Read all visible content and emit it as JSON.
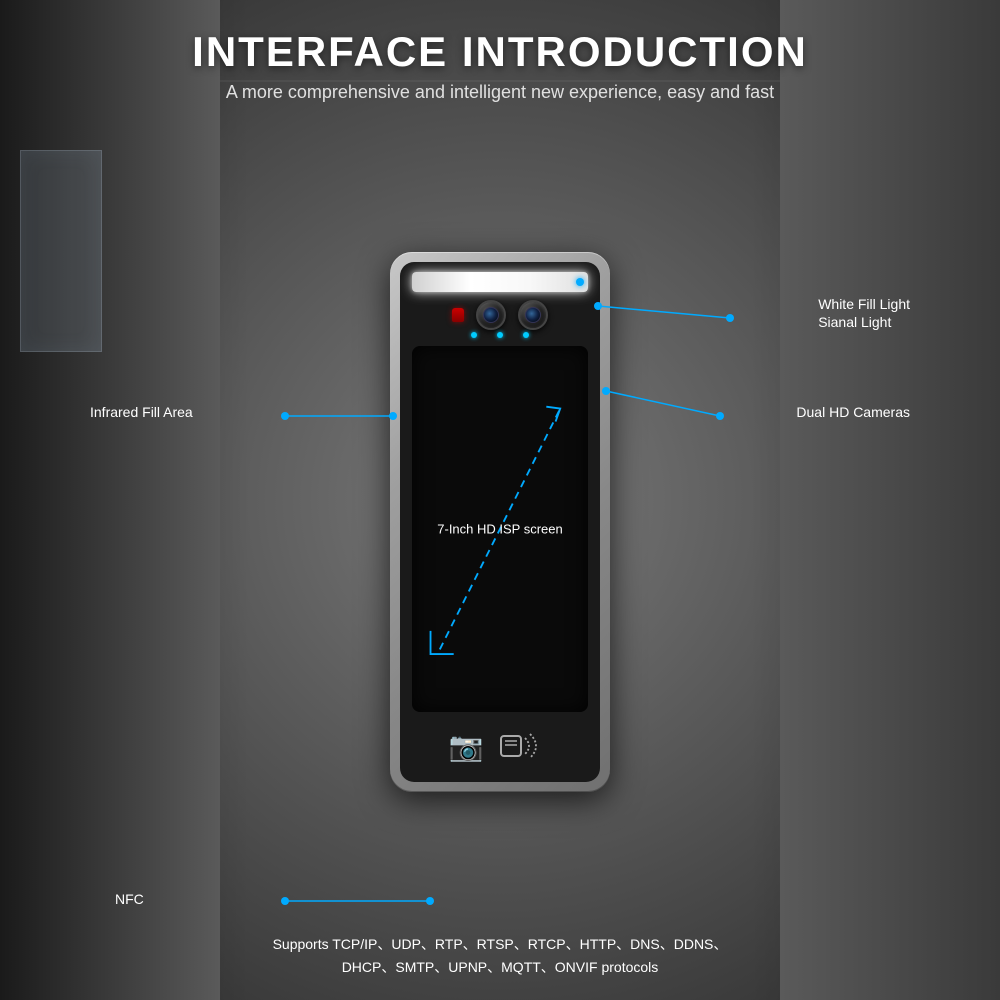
{
  "header": {
    "main_title": "INTERFACE INTRODUCTION",
    "subtitle": "A more comprehensive and intelligent new experience, easy and fast"
  },
  "device": {
    "screen_label": "7-Inch HD ISP screen"
  },
  "annotations": {
    "white_fill_light": "White Fill Light",
    "signal_light": "Sianal Light",
    "infrared_fill_area": "Infrared Fill Area",
    "dual_hd_cameras": "Dual HD Cameras",
    "nfc": "NFC"
  },
  "footer": {
    "line1": "Supports TCP/IP、UDP、RTP、RTSP、RTCP、HTTP、DNS、DDNS、",
    "line2": "DHCP、SMTP、UPNP、MQTT、ONVIF protocols"
  }
}
